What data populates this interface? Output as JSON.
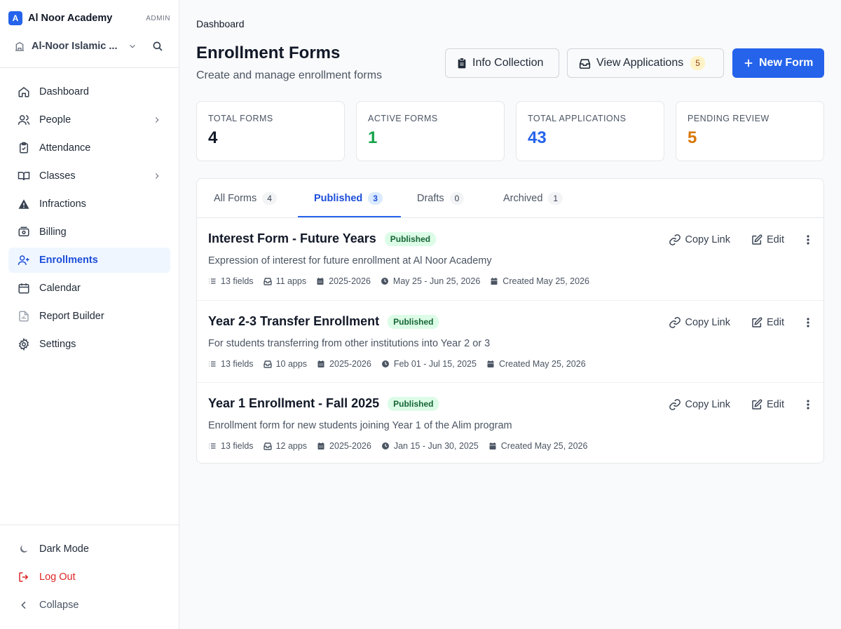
{
  "app": {
    "logo_letter": "A",
    "name": "Al Noor Academy",
    "role": "ADMIN"
  },
  "org": {
    "name": "Al-Noor Islamic ..."
  },
  "nav": [
    {
      "label": "Dashboard",
      "icon": "home-icon"
    },
    {
      "label": "People",
      "icon": "users-icon",
      "chevron": true
    },
    {
      "label": "Attendance",
      "icon": "clipboard-check-icon"
    },
    {
      "label": "Classes",
      "icon": "book-open-icon",
      "chevron": true
    },
    {
      "label": "Infractions",
      "icon": "warning-icon"
    },
    {
      "label": "Billing",
      "icon": "banknote-icon"
    },
    {
      "label": "Enrollments",
      "icon": "user-plus-icon",
      "active": true
    },
    {
      "label": "Calendar",
      "icon": "calendar-icon"
    },
    {
      "label": "Report Builder",
      "icon": "report-icon"
    },
    {
      "label": "Settings",
      "icon": "gear-icon"
    }
  ],
  "bottom_nav": {
    "dark_mode": "Dark Mode",
    "logout": "Log Out",
    "collapse": "Collapse"
  },
  "breadcrumb": "Dashboard",
  "header": {
    "title": "Enrollment Forms",
    "subtitle": "Create and manage enrollment forms",
    "info_collection": "Info Collection",
    "view_applications": "View Applications",
    "applications_count": "5",
    "new_form": "New Form"
  },
  "stats": [
    {
      "label": "TOTAL FORMS",
      "value": "4",
      "color": "#111827"
    },
    {
      "label": "ACTIVE FORMS",
      "value": "1",
      "color": "#16a34a"
    },
    {
      "label": "TOTAL APPLICATIONS",
      "value": "43",
      "color": "#2563eb"
    },
    {
      "label": "PENDING REVIEW",
      "value": "5",
      "color": "#d97706"
    }
  ],
  "tabs": [
    {
      "label": "All Forms",
      "count": "4"
    },
    {
      "label": "Published",
      "count": "3",
      "active": true
    },
    {
      "label": "Drafts",
      "count": "0"
    },
    {
      "label": "Archived",
      "count": "1"
    }
  ],
  "actions": {
    "copy_link": "Copy Link",
    "edit": "Edit"
  },
  "forms": [
    {
      "title": "Interest Form - Future Years",
      "status": "Published",
      "description": "Expression of interest for future enrollment at Al Noor Academy",
      "fields": "13 fields",
      "apps": "11 apps",
      "year": "2025-2026",
      "dates": "May 25 - Jun 25, 2026",
      "created": "Created May 25, 2026"
    },
    {
      "title": "Year 2-3 Transfer Enrollment",
      "status": "Published",
      "description": "For students transferring from other institutions into Year 2 or 3",
      "fields": "13 fields",
      "apps": "10 apps",
      "year": "2025-2026",
      "dates": "Feb 01 - Jul 15, 2025",
      "created": "Created May 25, 2026"
    },
    {
      "title": "Year 1 Enrollment - Fall 2025",
      "status": "Published",
      "description": "Enrollment form for new students joining Year 1 of the Alim program",
      "fields": "13 fields",
      "apps": "12 apps",
      "year": "2025-2026",
      "dates": "Jan 15 - Jun 30, 2025",
      "created": "Created May 25, 2026"
    }
  ]
}
